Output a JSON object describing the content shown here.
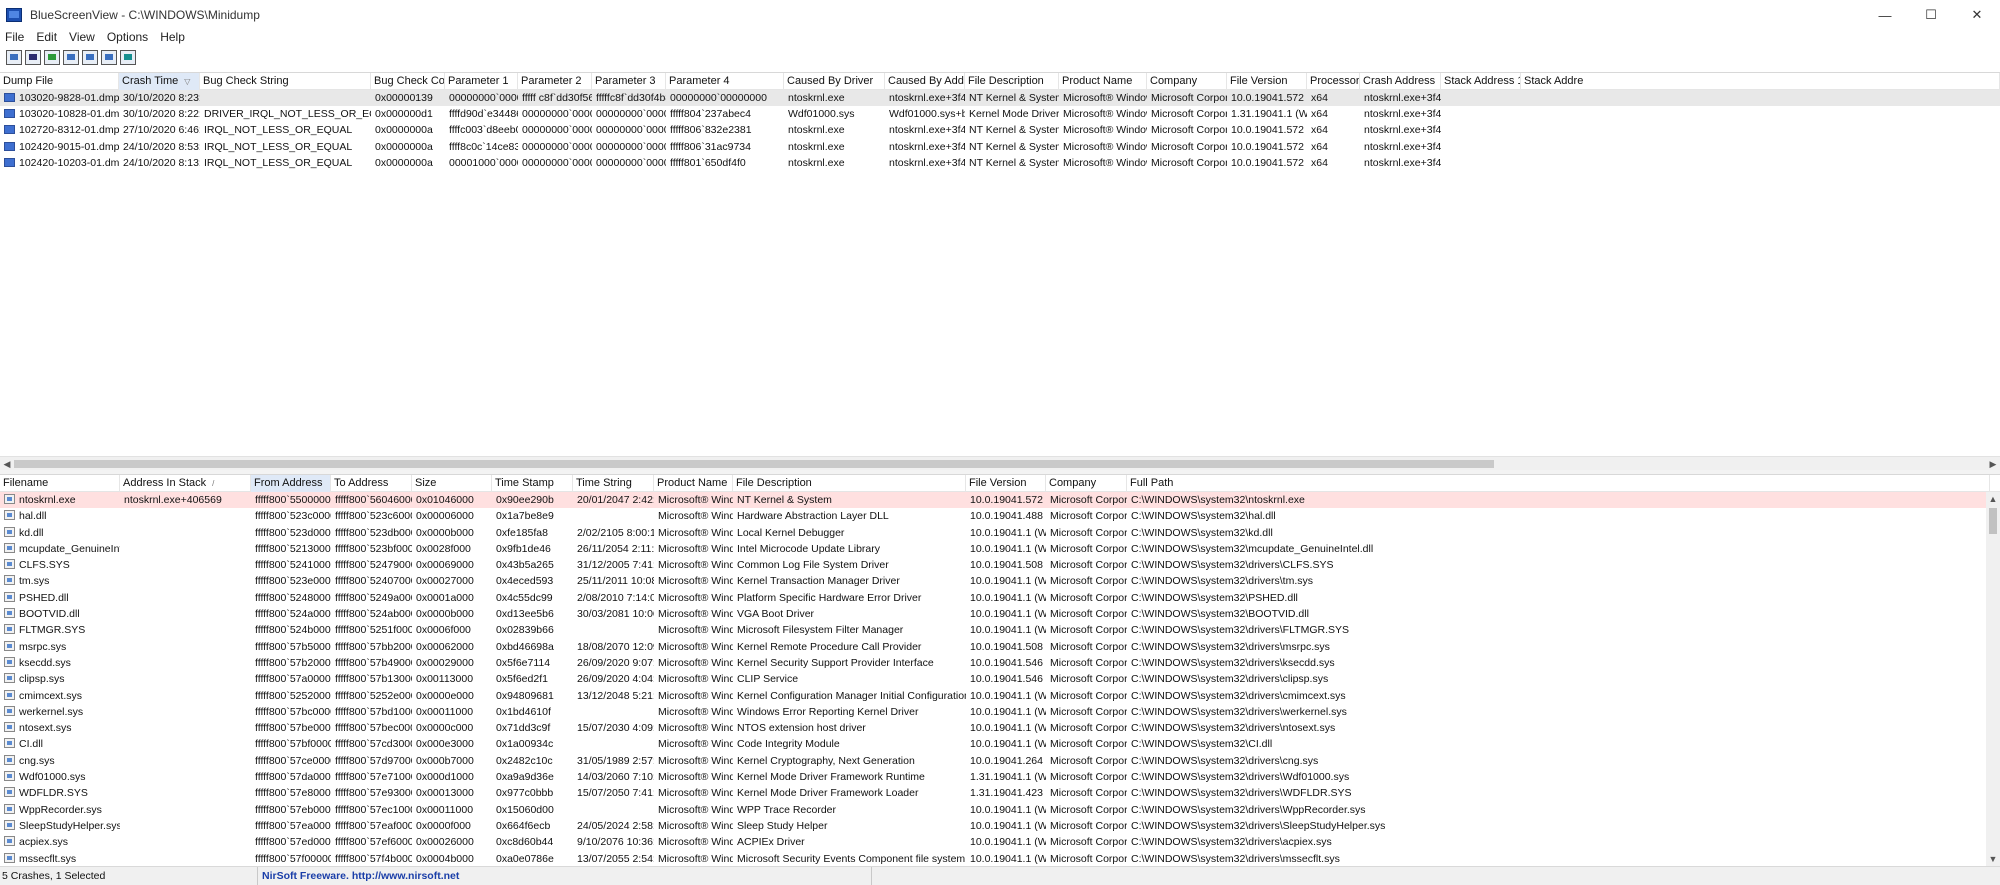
{
  "window": {
    "app_name": "BlueScreenView",
    "separator": "-",
    "path": "C:\\WINDOWS\\Minidump",
    "minimize": "—",
    "maximize": "☐",
    "close": "✕"
  },
  "menu": [
    "File",
    "Edit",
    "View",
    "Options",
    "Help"
  ],
  "toolbar": [
    "properties-icon",
    "save-icon",
    "refresh-icon",
    "copy-icon",
    "options-icon",
    "find-icon",
    "exit-icon"
  ],
  "crashes": {
    "columns": [
      {
        "label": "Dump File"
      },
      {
        "label": "Crash Time",
        "sorted": true,
        "arrow": "▽"
      },
      {
        "label": "Bug Check String"
      },
      {
        "label": "Bug Check Code"
      },
      {
        "label": "Parameter 1"
      },
      {
        "label": "Parameter 2"
      },
      {
        "label": "Parameter 3"
      },
      {
        "label": "Parameter 4"
      },
      {
        "label": "Caused By Driver"
      },
      {
        "label": "Caused By Address"
      },
      {
        "label": "File Description"
      },
      {
        "label": "Product Name"
      },
      {
        "label": "Company"
      },
      {
        "label": "File Version"
      },
      {
        "label": "Processor"
      },
      {
        "label": "Crash Address"
      },
      {
        "label": "Stack Address 1"
      },
      {
        "label": "Stack Addre"
      }
    ],
    "rows": [
      {
        "selected": true,
        "cells": [
          "103020-9828-01.dmp",
          "30/10/2020 8:23:17...",
          "",
          "0x00000139",
          "00000000`000000...",
          "fffff c8f`dd30f560",
          "fffffc8f`dd30f4b8",
          "00000000`00000000",
          "ntoskrnl.exe",
          "ntoskrnl.exe+3f45a0",
          "NT Kernel & System",
          "Microsoft® Window...",
          "Microsoft Corpora...",
          "10.0.19041.572 (Wi...",
          "x64",
          "ntoskrnl.exe+3f45a0",
          "",
          ""
        ]
      },
      {
        "selected": false,
        "cells": [
          "103020-10828-01.dmp",
          "30/10/2020 8:22:22...",
          "DRIVER_IRQL_NOT_LESS_OR_EQUAL",
          "0x000000d1",
          "ffffd90d`e3448678",
          "00000000`000000...",
          "00000000`000000...",
          "fffff804`237abec4",
          "Wdf01000.sys",
          "Wdf01000.sys+bec4",
          "Kernel Mode Driver Fr...",
          "Microsoft® Window...",
          "Microsoft Corpora...",
          "1.31.19041.1 (WinB...",
          "x64",
          "ntoskrnl.exe+3f45a0",
          "",
          ""
        ]
      },
      {
        "selected": false,
        "cells": [
          "102720-8312-01.dmp",
          "27/10/2020 6:46:26...",
          "IRQL_NOT_LESS_OR_EQUAL",
          "0x0000000a",
          "ffffc003`d8eeb0f8",
          "00000000`000000...",
          "00000000`000000...",
          "fffff806`832e2381",
          "ntoskrnl.exe",
          "ntoskrnl.exe+3f45a0",
          "NT Kernel & System",
          "Microsoft® Window...",
          "Microsoft Corpora...",
          "10.0.19041.572 (Wi...",
          "x64",
          "ntoskrnl.exe+3f45a0",
          "",
          ""
        ]
      },
      {
        "selected": false,
        "cells": [
          "102420-9015-01.dmp",
          "24/10/2020 8:53:51...",
          "IRQL_NOT_LESS_OR_EQUAL",
          "0x0000000a",
          "ffff8c0c`14ce83a8",
          "00000000`000000...",
          "00000000`000000...",
          "fffff806`31ac9734",
          "ntoskrnl.exe",
          "ntoskrnl.exe+3f45a0",
          "NT Kernel & System",
          "Microsoft® Window...",
          "Microsoft Corpora...",
          "10.0.19041.572 (Wi...",
          "x64",
          "ntoskrnl.exe+3f45a0",
          "",
          ""
        ]
      },
      {
        "selected": false,
        "cells": [
          "102420-10203-01.dmp",
          "24/10/2020 8:13:07...",
          "IRQL_NOT_LESS_OR_EQUAL",
          "0x0000000a",
          "00001000`000000...",
          "00000000`000000...",
          "00000000`000000...",
          "fffff801`650df4f0",
          "ntoskrnl.exe",
          "ntoskrnl.exe+3f45a0",
          "NT Kernel & System",
          "Microsoft® Window...",
          "Microsoft Corpora...",
          "10.0.19041.572 (Wi...",
          "x64",
          "ntoskrnl.exe+3f45a0",
          "",
          ""
        ]
      }
    ]
  },
  "modules": {
    "columns": [
      {
        "label": "Filename"
      },
      {
        "label": "Address In Stack",
        "arrow": "/"
      },
      {
        "label": "From Address",
        "sorted": true
      },
      {
        "label": "To Address"
      },
      {
        "label": "Size"
      },
      {
        "label": "Time Stamp"
      },
      {
        "label": "Time String"
      },
      {
        "label": "Product Name"
      },
      {
        "label": "File Description"
      },
      {
        "label": "File Version"
      },
      {
        "label": "Company"
      },
      {
        "label": "Full Path"
      }
    ],
    "rows": [
      {
        "selected": true,
        "cells": [
          "ntoskrnl.exe",
          "ntoskrnl.exe+406569",
          "fffff800`55000000",
          "fffff800`56046000",
          "0x01046000",
          "0x90ee290b",
          "20/01/2047 2:42:59...",
          "Microsoft® Wind...",
          "NT Kernel & System",
          "10.0.19041.572 (Wi...",
          "Microsoft Corpora...",
          "C:\\WINDOWS\\system32\\ntoskrnl.exe"
        ]
      },
      {
        "cells": [
          "hal.dll",
          "",
          "fffff800`523c0000",
          "fffff800`523c6000",
          "0x00006000",
          "0x1a7be8e9",
          "",
          "Microsoft® Wind...",
          "Hardware Abstraction Layer DLL",
          "10.0.19041.488 (Wi...",
          "Microsoft Corpora...",
          "C:\\WINDOWS\\system32\\hal.dll"
        ]
      },
      {
        "cells": [
          "kd.dll",
          "",
          "fffff800`523d0000",
          "fffff800`523db000",
          "0x0000b000",
          "0xfe185fa8",
          "2/02/2105 8:00:16 ...",
          "Microsoft® Wind...",
          "Local Kernel Debugger",
          "10.0.19041.1 (WinB...",
          "Microsoft Corpora...",
          "C:\\WINDOWS\\system32\\kd.dll"
        ]
      },
      {
        "cells": [
          "mcupdate_GenuineIntel.dll",
          "",
          "fffff800`52130000",
          "fffff800`523bf000",
          "0x0028f000",
          "0x9fb1de46",
          "26/11/2054 2:11:58...",
          "Microsoft® Wind...",
          "Intel Microcode Update Library",
          "10.0.19041.1 (WinB...",
          "Microsoft Corpora...",
          "C:\\WINDOWS\\system32\\mcupdate_GenuineIntel.dll"
        ]
      },
      {
        "cells": [
          "CLFS.SYS",
          "",
          "fffff800`52410000",
          "fffff800`52479000",
          "0x00069000",
          "0x43b5a265",
          "31/12/2005 7:41:01...",
          "Microsoft® Wind...",
          "Common Log File System Driver",
          "10.0.19041.508 (Wi...",
          "Microsoft Corpora...",
          "C:\\WINDOWS\\system32\\drivers\\CLFS.SYS"
        ]
      },
      {
        "cells": [
          "tm.sys",
          "",
          "fffff800`523e0000",
          "fffff800`52407000",
          "0x00027000",
          "0x4eced593",
          "25/11/2011 10:08:5...",
          "Microsoft® Wind...",
          "Kernel Transaction Manager Driver",
          "10.0.19041.1 (WinB...",
          "Microsoft Corpora...",
          "C:\\WINDOWS\\system32\\drivers\\tm.sys"
        ]
      },
      {
        "cells": [
          "PSHED.dll",
          "",
          "fffff800`52480000",
          "fffff800`5249a000",
          "0x0001a000",
          "0x4c55dc99",
          "2/08/2010 7:14:09 ...",
          "Microsoft® Wind...",
          "Platform Specific Hardware Error Driver",
          "10.0.19041.1 (WinB...",
          "Microsoft Corpora...",
          "C:\\WINDOWS\\system32\\PSHED.dll"
        ]
      },
      {
        "cells": [
          "BOOTVID.dll",
          "",
          "fffff800`524a0000",
          "fffff800`524ab000",
          "0x0000b000",
          "0xd13ee5b6",
          "30/03/2081 10:06:2...",
          "Microsoft® Wind...",
          "VGA Boot Driver",
          "10.0.19041.1 (WinB...",
          "Microsoft Corpora...",
          "C:\\WINDOWS\\system32\\BOOTVID.dll"
        ]
      },
      {
        "cells": [
          "FLTMGR.SYS",
          "",
          "fffff800`524b0000",
          "fffff800`5251f000",
          "0x0006f000",
          "0x02839b66",
          "",
          "Microsoft® Wind...",
          "Microsoft Filesystem Filter Manager",
          "10.0.19041.1 (WinB...",
          "Microsoft Corpora...",
          "C:\\WINDOWS\\system32\\drivers\\FLTMGR.SYS"
        ]
      },
      {
        "cells": [
          "msrpc.sys",
          "",
          "fffff800`57b50000",
          "fffff800`57bb2000",
          "0x00062000",
          "0xbd46698a",
          "18/08/2070 12:09:2...",
          "Microsoft® Wind...",
          "Kernel Remote Procedure Call Provider",
          "10.0.19041.508 (Wi...",
          "Microsoft Corpora...",
          "C:\\WINDOWS\\system32\\drivers\\msrpc.sys"
        ]
      },
      {
        "cells": [
          "ksecdd.sys",
          "",
          "fffff800`57b20000",
          "fffff800`57b49000",
          "0x00029000",
          "0x5f6e7114",
          "26/09/2020 9:07:08...",
          "Microsoft® Wind...",
          "Kernel Security Support Provider Interface",
          "10.0.19041.546 (Wi...",
          "Microsoft Corpora...",
          "C:\\WINDOWS\\system32\\drivers\\ksecdd.sys"
        ]
      },
      {
        "cells": [
          "clipsp.sys",
          "",
          "fffff800`57a00000",
          "fffff800`57b13000",
          "0x00113000",
          "0x5f6ed2f1",
          "26/09/2020 4:04:41...",
          "Microsoft® Wind...",
          "CLIP Service",
          "10.0.19041.546 (Wi...",
          "Microsoft Corpora...",
          "C:\\WINDOWS\\system32\\drivers\\clipsp.sys"
        ]
      },
      {
        "cells": [
          "cmimcext.sys",
          "",
          "fffff800`52520000",
          "fffff800`5252e000",
          "0x0000e000",
          "0x94809681",
          "13/12/2048 5:21:45...",
          "Microsoft® Wind...",
          "Kernel Configuration Manager Initial Configuration Extension ...",
          "10.0.19041.1 (WinB...",
          "Microsoft Corpora...",
          "C:\\WINDOWS\\system32\\drivers\\cmimcext.sys"
        ]
      },
      {
        "cells": [
          "werkernel.sys",
          "",
          "fffff800`57bc0000",
          "fffff800`57bd1000",
          "0x00011000",
          "0x1bd4610f",
          "",
          "Microsoft® Wind...",
          "Windows Error Reporting Kernel Driver",
          "10.0.19041.1 (WinB...",
          "Microsoft Corpora...",
          "C:\\WINDOWS\\system32\\drivers\\werkernel.sys"
        ]
      },
      {
        "cells": [
          "ntosext.sys",
          "",
          "fffff800`57be0000",
          "fffff800`57bec000",
          "0x0000c000",
          "0x71dd3c9f",
          "15/07/2030 4:09:43...",
          "Microsoft® Wind...",
          "NTOS extension host driver",
          "10.0.19041.1 (WinB...",
          "Microsoft Corpora...",
          "C:\\WINDOWS\\system32\\drivers\\ntosext.sys"
        ]
      },
      {
        "cells": [
          "CI.dll",
          "",
          "fffff800`57bf0000",
          "fffff800`57cd3000",
          "0x000e3000",
          "0x1a00934c",
          "",
          "Microsoft® Wind...",
          "Code Integrity Module",
          "10.0.19041.1 (WinB...",
          "Microsoft Corpora...",
          "C:\\WINDOWS\\system32\\CI.dll"
        ]
      },
      {
        "cells": [
          "cng.sys",
          "",
          "fffff800`57ce0000",
          "fffff800`57d97000",
          "0x000b7000",
          "0x2482c10c",
          "31/05/1989 2:57:56...",
          "Microsoft® Wind...",
          "Kernel Cryptography, Next Generation",
          "10.0.19041.264 (Wi...",
          "Microsoft Corpora...",
          "C:\\WINDOWS\\system32\\drivers\\cng.sys"
        ]
      },
      {
        "cells": [
          "Wdf01000.sys",
          "",
          "fffff800`57da0000",
          "fffff800`57e71000",
          "0x000d1000",
          "0xa9a9d36e",
          "14/03/2060 7:10:14...",
          "Microsoft® Wind...",
          "Kernel Mode Driver Framework Runtime",
          "1.31.19041.1 (WinB...",
          "Microsoft Corpora...",
          "C:\\WINDOWS\\system32\\drivers\\Wdf01000.sys"
        ]
      },
      {
        "cells": [
          "WDFLDR.SYS",
          "",
          "fffff800`57e80000",
          "fffff800`57e93000",
          "0x00013000",
          "0x977c0bbb",
          "15/07/2050 7:41:23...",
          "Microsoft® Wind...",
          "Kernel Mode Driver Framework Loader",
          "1.31.19041.423 (Wi...",
          "Microsoft Corpora...",
          "C:\\WINDOWS\\system32\\drivers\\WDFLDR.SYS"
        ]
      },
      {
        "cells": [
          "WppRecorder.sys",
          "",
          "fffff800`57eb0000",
          "fffff800`57ec1000",
          "0x00011000",
          "0x15060d00",
          "",
          "Microsoft® Wind...",
          "WPP Trace Recorder",
          "10.0.19041.1 (WinB...",
          "Microsoft Corpora...",
          "C:\\WINDOWS\\system32\\drivers\\WppRecorder.sys"
        ]
      },
      {
        "cells": [
          "SleepStudyHelper.sys",
          "",
          "fffff800`57ea0000",
          "fffff800`57eaf000",
          "0x0000f000",
          "0x664f6ecb",
          "24/05/2024 2:58:59...",
          "Microsoft® Wind...",
          "Sleep Study Helper",
          "10.0.19041.1 (WinB...",
          "Microsoft Corpora...",
          "C:\\WINDOWS\\system32\\drivers\\SleepStudyHelper.sys"
        ]
      },
      {
        "cells": [
          "acpiex.sys",
          "",
          "fffff800`57ed0000",
          "fffff800`57ef6000",
          "0x00026000",
          "0xc8d60b44",
          "9/10/2076 10:36:28...",
          "Microsoft® Wind...",
          "ACPIEx Driver",
          "10.0.19041.1 (WinB...",
          "Microsoft Corpora...",
          "C:\\WINDOWS\\system32\\drivers\\acpiex.sys"
        ]
      },
      {
        "cells": [
          "mssecflt.sys",
          "",
          "fffff800`57f00000",
          "fffff800`57f4b000",
          "0x0004b000",
          "0xa0e0786e",
          "13/07/2055 2:54:14...",
          "Microsoft® Wind...",
          "Microsoft Security Events Component file system filter driver",
          "10.0.19041.1 (WinB...",
          "Microsoft Corpora...",
          "C:\\WINDOWS\\system32\\drivers\\mssecflt.sys"
        ]
      }
    ]
  },
  "status": {
    "summary": "5 Crashes, 1 Selected",
    "credit": "NirSoft Freeware.  http://www.nirsoft.net"
  }
}
